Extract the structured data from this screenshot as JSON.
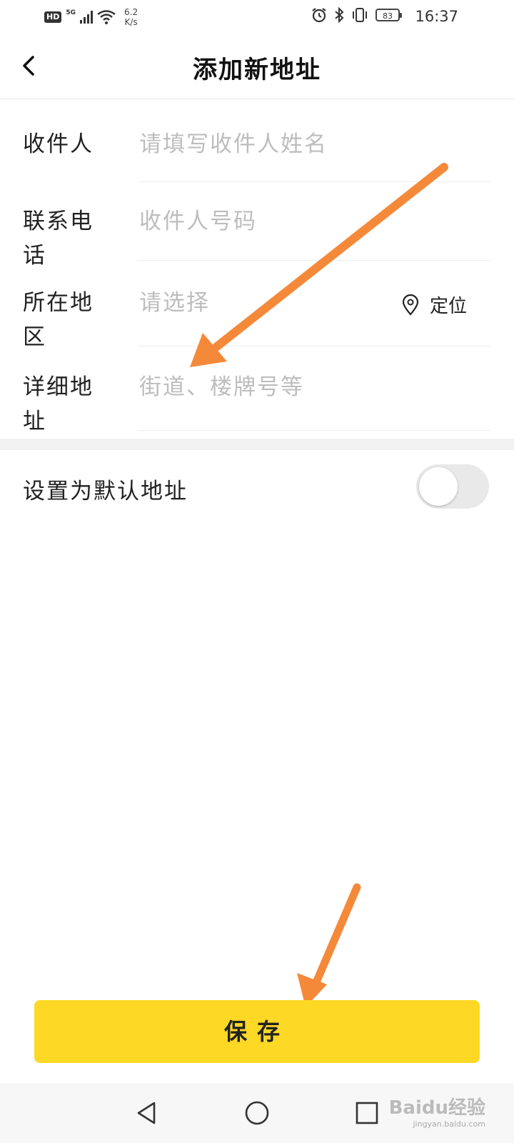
{
  "status_bar": {
    "hd": "HD",
    "net": "5G",
    "speed_value": "6.2",
    "speed_unit": "K/s",
    "battery": "83",
    "time": "16:37"
  },
  "header": {
    "title": "添加新地址",
    "back_icon": "chevron-left-icon"
  },
  "form": {
    "recipient": {
      "label": "收件人",
      "placeholder": "请填写收件人姓名"
    },
    "phone": {
      "label": "联系电话",
      "placeholder": "收件人号码"
    },
    "region": {
      "label": "所在地区",
      "placeholder": "请选择",
      "locate_label": "定位",
      "locate_icon": "location-pin-icon"
    },
    "address": {
      "label": "详细地址",
      "placeholder": "街道、楼牌号等"
    }
  },
  "default_setting": {
    "label": "设置为默认地址",
    "enabled": false
  },
  "save_label": "保存",
  "system_nav": {
    "back": "triangle-back-icon",
    "home": "circle-home-icon",
    "recent": "square-recent-icon"
  },
  "watermark": {
    "main": "Baidu经验",
    "sub": "jingyan.baidu.com"
  },
  "colors": {
    "accent": "#fdd825",
    "placeholder": "#bdbdbd",
    "annotation_arrow": "#f5893a"
  }
}
